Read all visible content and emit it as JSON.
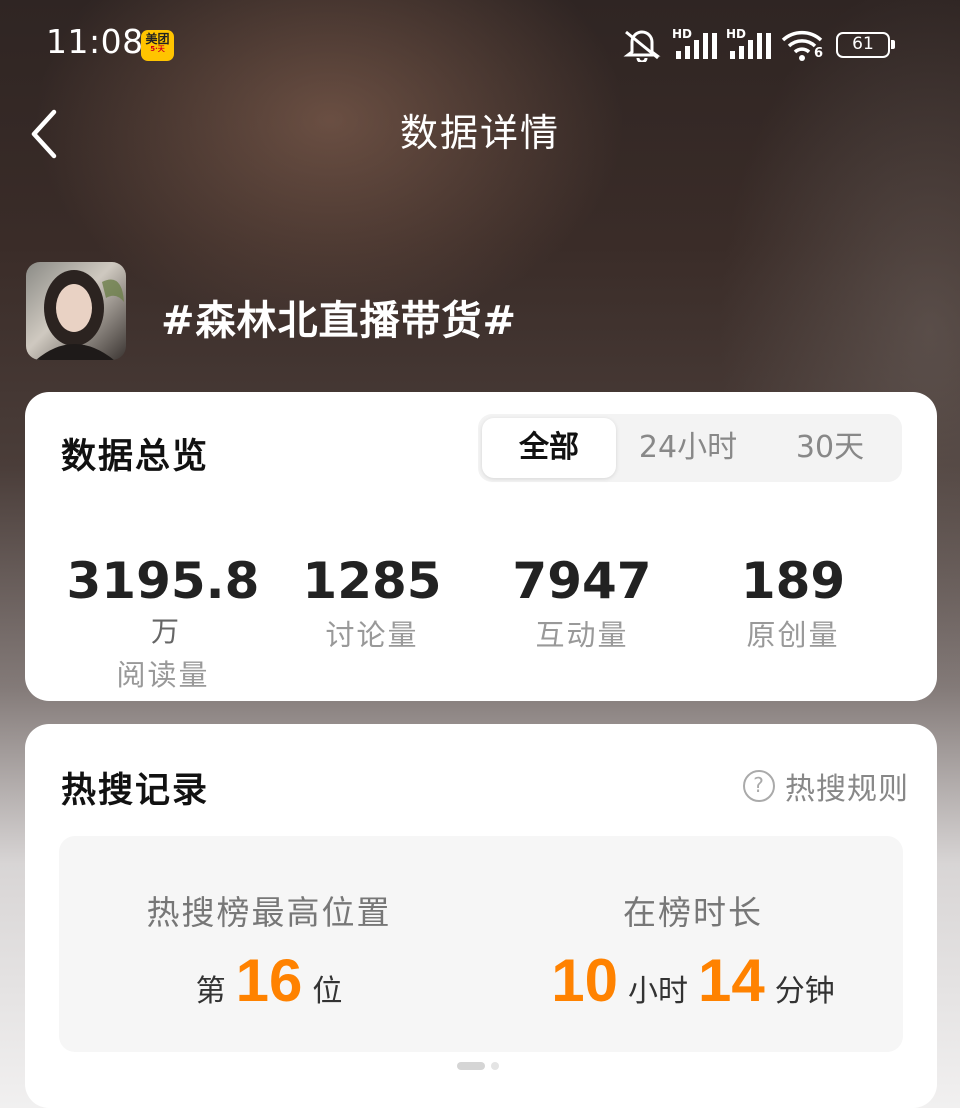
{
  "status_bar": {
    "time": "11:08",
    "app_badge": "美团",
    "app_badge_sub": "5·天",
    "network_1": "HD",
    "network_2": "HD",
    "wifi_label": "6",
    "battery": "61"
  },
  "nav": {
    "title": "数据详情"
  },
  "topic": {
    "title": "#森林北直播带货#"
  },
  "overview": {
    "title": "数据总览",
    "tabs": [
      {
        "label": "全部",
        "active": true
      },
      {
        "label": "24小时",
        "active": false
      },
      {
        "label": "30天",
        "active": false
      }
    ],
    "stats": [
      {
        "value": "3195.8",
        "unit": "万",
        "label": "阅读量"
      },
      {
        "value": "1285",
        "unit": "",
        "label": "讨论量"
      },
      {
        "value": "7947",
        "unit": "",
        "label": "互动量"
      },
      {
        "value": "189",
        "unit": "",
        "label": "原创量"
      }
    ]
  },
  "hot_search": {
    "title": "热搜记录",
    "rules_label": "热搜规则",
    "highest": {
      "label": "热搜榜最高位置",
      "prefix": "第",
      "value": "16",
      "suffix": "位"
    },
    "duration": {
      "label": "在榜时长",
      "hours": "10",
      "hours_unit": "小时",
      "minutes": "14",
      "minutes_unit": "分钟"
    }
  },
  "colors": {
    "accent_orange": "#ff8200"
  }
}
